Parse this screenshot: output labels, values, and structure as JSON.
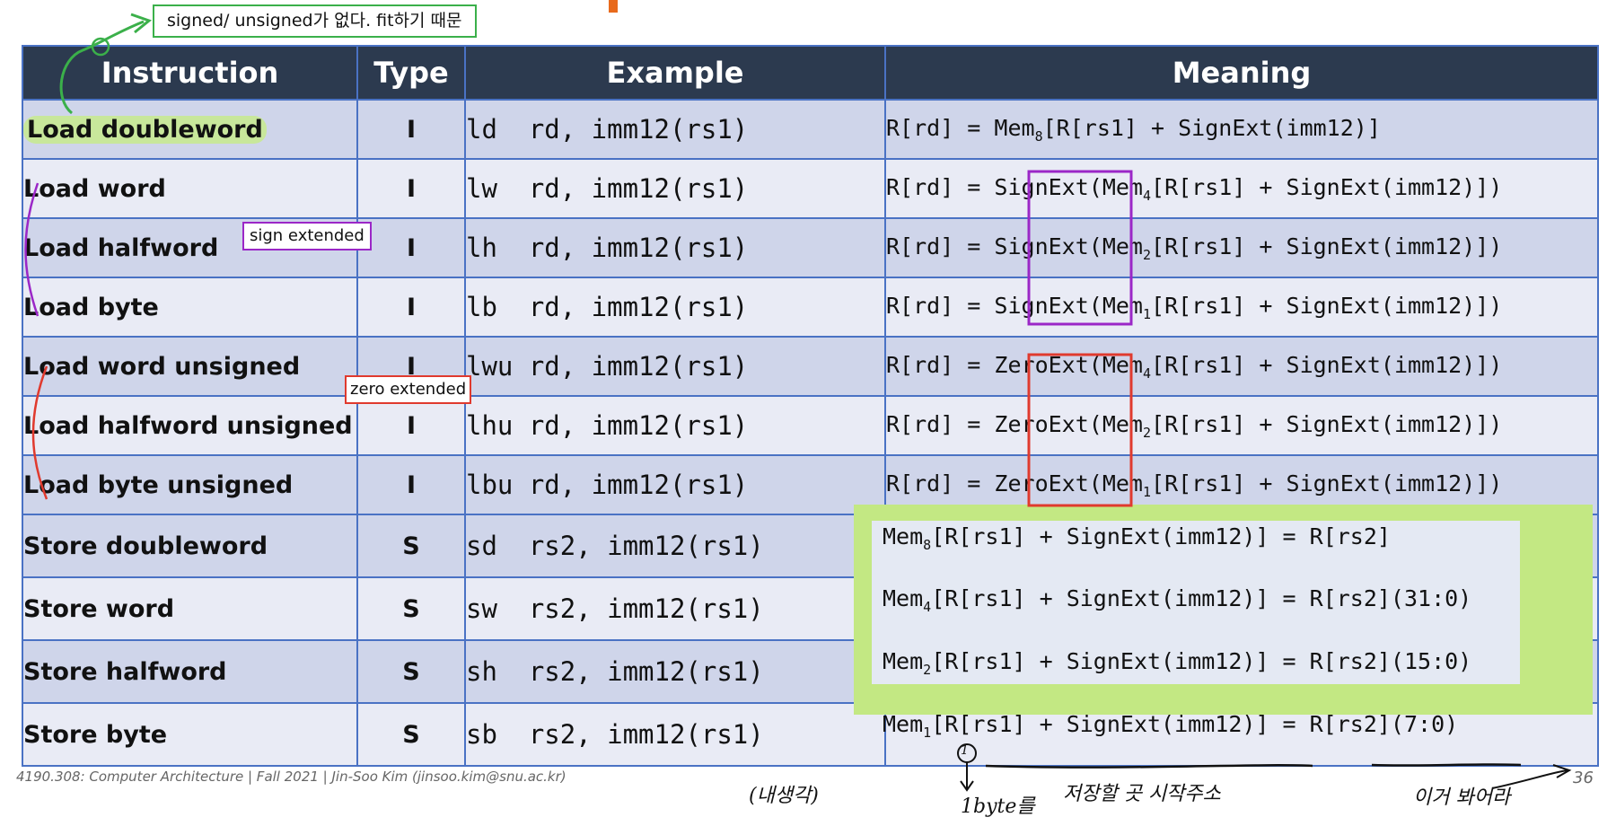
{
  "header": {
    "instruction": "Instruction",
    "type": "Type",
    "example": "Example",
    "meaning": "Meaning"
  },
  "loads": [
    {
      "instruction": "Load doubleword",
      "type": "I",
      "example": "ld  rd, imm12(rs1)",
      "pre": "R[rd] = Mem",
      "sub": "8",
      "post": "[R[rs1] + SignExt(imm12)]"
    },
    {
      "instruction": "Load word",
      "type": "I",
      "example": "lw  rd, imm12(rs1)",
      "pre": "R[rd] = SignExt(Mem",
      "sub": "4",
      "post": "[R[rs1] + SignExt(imm12)])"
    },
    {
      "instruction": "Load halfword",
      "type": "I",
      "example": "lh  rd, imm12(rs1)",
      "pre": "R[rd] = SignExt(Mem",
      "sub": "2",
      "post": "[R[rs1] + SignExt(imm12)])"
    },
    {
      "instruction": "Load byte",
      "type": "I",
      "example": "lb  rd, imm12(rs1)",
      "pre": "R[rd] = SignExt(Mem",
      "sub": "1",
      "post": "[R[rs1] + SignExt(imm12)])"
    },
    {
      "instruction": "Load word unsigned",
      "type": "I",
      "example": "lwu rd, imm12(rs1)",
      "pre": "R[rd] = ZeroExt(Mem",
      "sub": "4",
      "post": "[R[rs1] + SignExt(imm12)])"
    },
    {
      "instruction": "Load halfword unsigned",
      "type": "I",
      "example": "lhu rd, imm12(rs1)",
      "pre": "R[rd] = ZeroExt(Mem",
      "sub": "2",
      "post": "[R[rs1] + SignExt(imm12)])"
    },
    {
      "instruction": "Load byte unsigned",
      "type": "I",
      "example": "lbu rd, imm12(rs1)",
      "pre": "R[rd] = ZeroExt(Mem",
      "sub": "1",
      "post": "[R[rs1] + SignExt(imm12)])"
    }
  ],
  "stores": [
    {
      "instruction": "Store doubleword",
      "type": "S",
      "example": "sd  rs2, imm12(rs1)",
      "pre": "Mem",
      "sub": "8",
      "post": "[R[rs1] + SignExt(imm12)] = R[rs2]"
    },
    {
      "instruction": "Store word",
      "type": "S",
      "example": "sw  rs2, imm12(rs1)",
      "pre": "Mem",
      "sub": "4",
      "post": "[R[rs1] + SignExt(imm12)] = R[rs2](31:0)"
    },
    {
      "instruction": "Store halfword",
      "type": "S",
      "example": "sh  rs2, imm12(rs1)",
      "pre": "Mem",
      "sub": "2",
      "post": "[R[rs1] + SignExt(imm12)] = R[rs2](15:0)"
    },
    {
      "instruction": "Store byte",
      "type": "S",
      "example": "sb  rs2, imm12(rs1)",
      "pre": "Mem",
      "sub": "1",
      "post": "[R[rs1] + SignExt(imm12)] = R[rs2](7:0)"
    }
  ],
  "annotations": {
    "green_note": "signed/ unsigned가 없다. fit하기 때문",
    "purple_note": "sign extended",
    "red_note": "zero extended",
    "hand_naesaenggak": "(내생각)",
    "hand_circle_one": "1",
    "hand_1byte": "1byte를",
    "hand_store_addr": "저장할 곳 시작주소",
    "hand_look_here": "이거 봐어라"
  },
  "colors": {
    "header_bg": "#2c3a4f",
    "row_dark": "#cfd5ea",
    "row_light": "#e9ebf5",
    "border": "#4a72c4",
    "green": "#3bb04a",
    "purple": "#9b27c7",
    "red": "#e03a2e",
    "lime": "#c3e883"
  },
  "footer": {
    "text": "4190.308: Computer Architecture | Fall 2021 | Jin-Soo Kim (jinsoo.kim@snu.ac.kr)",
    "page": "36"
  }
}
